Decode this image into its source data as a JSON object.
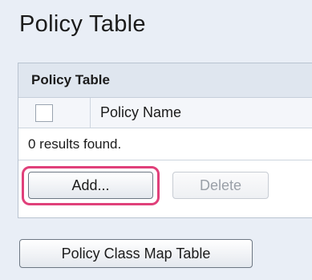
{
  "page": {
    "title": "Policy Table"
  },
  "table": {
    "header": "Policy Table",
    "columns": [
      "",
      "Policy Name"
    ],
    "results_text": "0 results found."
  },
  "buttons": {
    "add": "Add...",
    "delete": "Delete",
    "class_map_table": "Policy Class Map Table"
  },
  "colors": {
    "highlight": "#e0407a",
    "background": "#e9eef6",
    "header_bg": "#dfe6ef"
  }
}
